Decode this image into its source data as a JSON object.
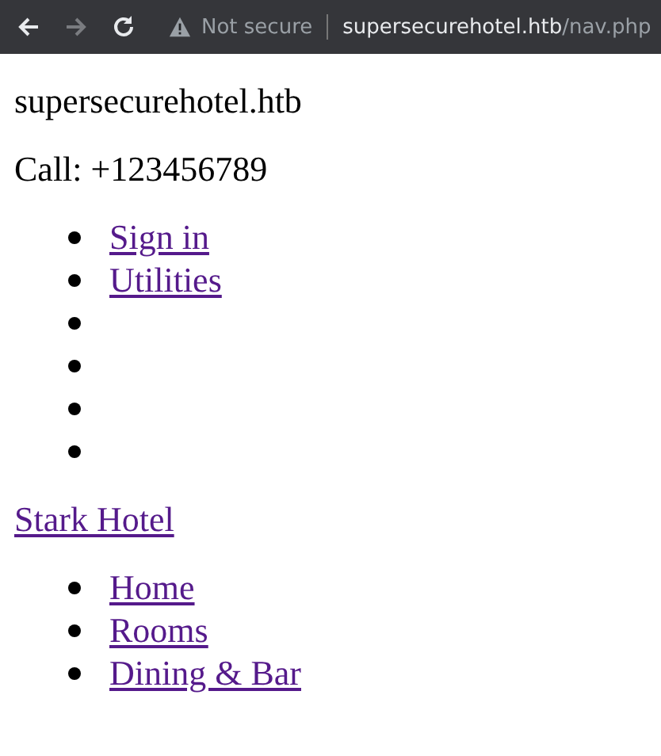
{
  "browser": {
    "security_label": "Not secure",
    "url_host": "supersecurehotel.htb",
    "url_path": "/nav.php",
    "forward_disabled": true
  },
  "site_title": "supersecurehotel.htb",
  "phone": "Call: +123456789",
  "top_menu": [
    {
      "kind": "link",
      "label": "Sign in"
    },
    {
      "kind": "link",
      "label": "Utilities"
    },
    {
      "kind": "empty"
    },
    {
      "kind": "empty"
    },
    {
      "kind": "empty"
    },
    {
      "kind": "empty"
    }
  ],
  "brand_link": "Stark Hotel",
  "main_menu": [
    {
      "kind": "link",
      "label": "Home"
    },
    {
      "kind": "link",
      "label": "Rooms"
    },
    {
      "kind": "link",
      "label": "Dining & Bar"
    }
  ]
}
